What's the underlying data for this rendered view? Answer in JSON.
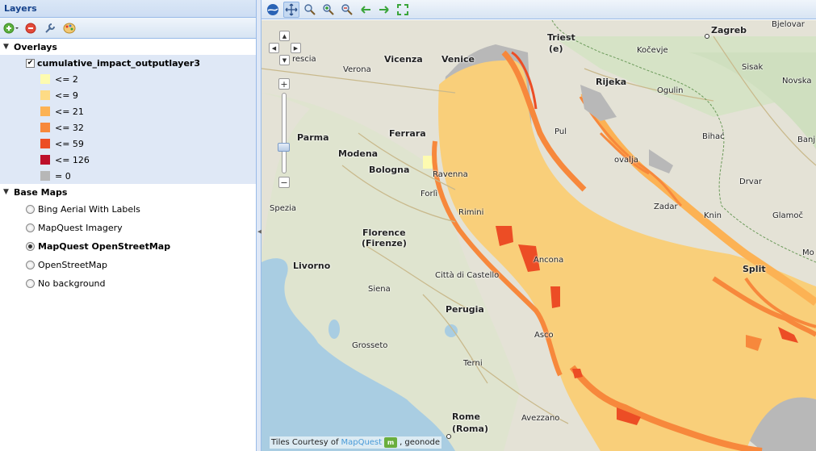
{
  "panel": {
    "title": "Layers"
  },
  "tree": {
    "overlays_label": "Overlays",
    "layer_name": "cumulative_impact_outputlayer3",
    "legend": [
      {
        "label": "<= 2",
        "color": "#fdfbb0"
      },
      {
        "label": "<= 9",
        "color": "#fddb85"
      },
      {
        "label": "<= 21",
        "color": "#fcb254"
      },
      {
        "label": "<= 32",
        "color": "#f7883c"
      },
      {
        "label": "<= 59",
        "color": "#ec4d25"
      },
      {
        "label": "<= 126",
        "color": "#bd0f2a"
      },
      {
        "label": "= 0",
        "color": "#b7b7b7"
      }
    ],
    "basemaps_label": "Base Maps",
    "basemaps": [
      {
        "label": "Bing Aerial With Labels",
        "checked": false
      },
      {
        "label": "MapQuest Imagery",
        "checked": false
      },
      {
        "label": "MapQuest OpenStreetMap",
        "checked": true
      },
      {
        "label": "OpenStreetMap",
        "checked": false
      },
      {
        "label": "No background",
        "checked": false
      }
    ]
  },
  "map": {
    "attribution_prefix": "Tiles Courtesy of",
    "attribution_link": "MapQuest",
    "attribution_suffix": ", geonode",
    "logo_text": "m",
    "cities": {
      "trieste": "Triest",
      "trieste2": "(e)",
      "zagreb": "Zagreb",
      "bjelovar": "Bjelovar",
      "vicenza": "Vicenza",
      "venice": "Venice",
      "verona": "Verona",
      "brescia": "rescia",
      "rijeka": "Rijeka",
      "kokevje": "Kočevje",
      "sisak": "Sisak",
      "novska": "Novska",
      "ogulin": "Ogulin",
      "ferrara": "Ferrara",
      "parma": "Parma",
      "modena": "Modena",
      "bologna": "Bologna",
      "ravenna": "Ravenna",
      "forli": "Forlì",
      "rimini": "Rimini",
      "spezia": "Spezia",
      "florence": "Florence",
      "florence2": "(Firenze)",
      "livorno": "Livorno",
      "siena": "Siena",
      "cdc": "Città di Castello",
      "ancona": "Ancona",
      "perugia": "Perugia",
      "grosseto": "Grosseto",
      "terni": "Terni",
      "rome": "Rome",
      "rome2": "(Roma)",
      "avezzano": "Avezzano",
      "ascoli": "Asco",
      "zadar": "Zadar",
      "bihac": "Bihać",
      "knin": "Knin",
      "drvar": "Drvar",
      "glamoc": "Glamoč",
      "split": "Split",
      "banja": "Banj",
      "pula": "Pul",
      "novalja": "ovalja",
      "mo": "Mo"
    }
  },
  "colors": {
    "accent": "#15428b",
    "sea": "#f9cf7a",
    "grey_zone": "#b7b7b7"
  }
}
